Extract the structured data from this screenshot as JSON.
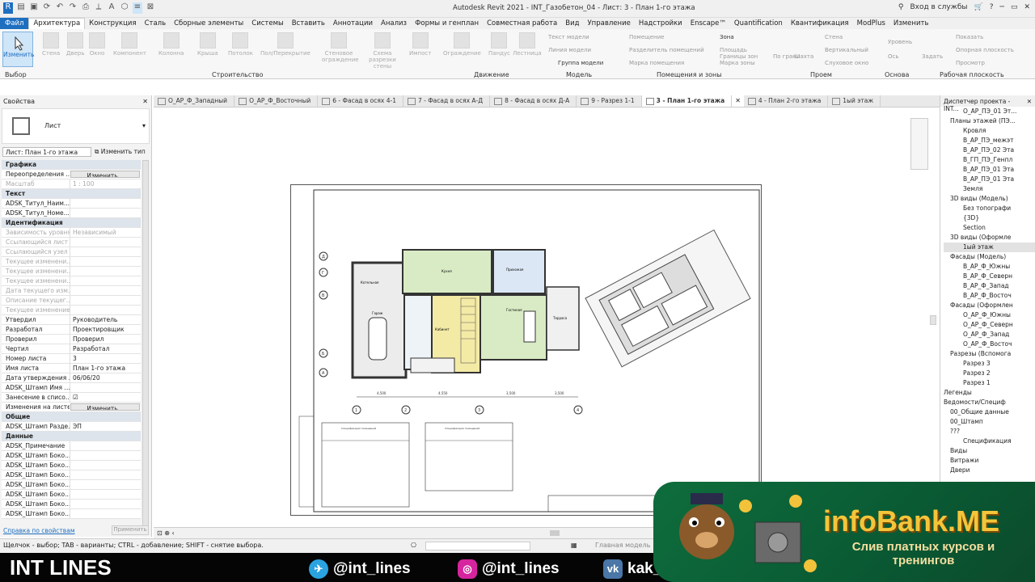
{
  "window": {
    "title": "Autodesk Revit 2021 - INT_Газобетон_04 - Лист: 3 - План 1-го этажа",
    "signin": "Вход в службы"
  },
  "menu": [
    "Файл",
    "Архитектура",
    "Конструкция",
    "Сталь",
    "Сборные элементы",
    "Системы",
    "Вставить",
    "Аннотации",
    "Анализ",
    "Формы и генплан",
    "Совместная работа",
    "Вид",
    "Управление",
    "Надстройки",
    "Enscape™",
    "Quantification",
    "Квантификация",
    "ModPlus",
    "Изменить"
  ],
  "ribbon": {
    "select_label": "Изменить",
    "select_group": "Выбор",
    "build_items": [
      "Стена",
      "Дверь",
      "Окно",
      "Компонент",
      "Колонна",
      "Крыша",
      "Потолок",
      "Пол/Перекрытие",
      "Стеновое ограждение",
      "Схема разрезки стены",
      "Импост",
      "Ограждение",
      "Пандус",
      "Лестница"
    ],
    "model_items": [
      "Текст модели",
      "Линия модели",
      "Группа модели"
    ],
    "room_items": [
      "Помещение",
      "Разделитель помещений",
      "Марка помещения",
      "Зона",
      "Площадь",
      "Границы зон",
      "Марка зоны"
    ],
    "opening_items": [
      "По грани",
      "Шахта",
      "Стена",
      "Вертикальный",
      "Слуховое окно"
    ],
    "datum_items": [
      "Уровень",
      "Ось"
    ],
    "wp_items": [
      "Задать",
      "Показать",
      "Опорная плоскость",
      "Просмотр"
    ],
    "groups": [
      "Выбор",
      "Строительство",
      "Движение",
      "Модель",
      "Помещения и зоны",
      "Проем",
      "Основа",
      "Рабочая плоскость"
    ]
  },
  "properties": {
    "header": "Свойства",
    "type_name": "Лист",
    "filter_value": "Лист: План 1-го этажа",
    "edit_type": "Изменить тип",
    "rows": [
      {
        "sec": "Графика"
      },
      {
        "k": "Переопределения ...",
        "v": "Изменить...",
        "btn": true
      },
      {
        "k": "Масштаб",
        "v": "1 : 100",
        "dim": true
      },
      {
        "sec": "Текст"
      },
      {
        "k": "ADSK_Титул_Наим...",
        "v": ""
      },
      {
        "k": "ADSK_Титул_Номе...",
        "v": ""
      },
      {
        "sec": "Идентификация"
      },
      {
        "k": "Зависимость уровня",
        "v": "Независимый",
        "dim": true
      },
      {
        "k": "Ссылающийся лист",
        "v": "",
        "dim": true
      },
      {
        "k": "Ссылающийся узел",
        "v": "",
        "dim": true
      },
      {
        "k": "Текущее изменени...",
        "v": "",
        "dim": true
      },
      {
        "k": "Текущее изменени...",
        "v": "",
        "dim": true
      },
      {
        "k": "Текущее изменени...",
        "v": "",
        "dim": true
      },
      {
        "k": "Дата текущего изм...",
        "v": "",
        "dim": true
      },
      {
        "k": "Описание текущег...",
        "v": "",
        "dim": true
      },
      {
        "k": "Текущее изменение",
        "v": "",
        "dim": true
      },
      {
        "k": "Утвердил",
        "v": "Руководитель"
      },
      {
        "k": "Разработал",
        "v": "Проектировщик"
      },
      {
        "k": "Проверил",
        "v": "Проверил"
      },
      {
        "k": "Чертил",
        "v": "Разработал"
      },
      {
        "k": "Номер листа",
        "v": "3"
      },
      {
        "k": "Имя листа",
        "v": "План 1-го этажа"
      },
      {
        "k": "Дата утверждения ...",
        "v": "06/06/20"
      },
      {
        "k": "ADSK_Штамп Имя ...",
        "v": ""
      },
      {
        "k": "Занесение в списо...",
        "v": "☑"
      },
      {
        "k": "Изменения на листе",
        "v": "Изменить...",
        "btn": true
      },
      {
        "sec": "Общие"
      },
      {
        "k": "ADSK_Штамп Разде...",
        "v": "ЭП"
      },
      {
        "sec": "Данные"
      },
      {
        "k": "ADSK_Примечание",
        "v": ""
      },
      {
        "k": "ADSK_Штамп Боко...",
        "v": ""
      },
      {
        "k": "ADSK_Штамп Боко...",
        "v": ""
      },
      {
        "k": "ADSK_Штамп Боко...",
        "v": ""
      },
      {
        "k": "ADSK_Штамп Боко...",
        "v": ""
      },
      {
        "k": "ADSK_Штамп Боко...",
        "v": ""
      },
      {
        "k": "ADSK_Штамп Боко...",
        "v": ""
      },
      {
        "k": "ADSK_Штамп Боко...",
        "v": ""
      }
    ],
    "help_link": "Справка по свойствам",
    "apply": "Применить"
  },
  "tabs": [
    {
      "label": "О_АР_Ф_Западный"
    },
    {
      "label": "О_АР_Ф_Восточный"
    },
    {
      "label": "6 - Фасад в осях 4-1"
    },
    {
      "label": "7 - Фасад в осях А-Д"
    },
    {
      "label": "8 - Фасад в осях Д-А"
    },
    {
      "label": "9 - Разрез 1-1"
    },
    {
      "label": "3 - План 1-го этажа",
      "active": true
    },
    {
      "label": "4 - План 2-го этажа"
    },
    {
      "label": "1ый этаж"
    }
  ],
  "project_browser": {
    "header": "Диспетчер проекта - INT...",
    "items": [
      "О_АР_ПЭ_01 Эт...",
      "Планы этажей (ПЭ...",
      "Кровля",
      "В_АР_ПЭ_межэт",
      "В_АР_ПЭ_02 Эта",
      "В_ГП_ПЭ_Генпл",
      "В_АР_ПЭ_01 Эта",
      "В_АР_ПЭ_01 Эта",
      "Земля",
      "3D виды (Модель)",
      "Без топографи",
      "{3D}",
      "Section",
      "3D виды (Оформле",
      "1ый этаж",
      "Фасады (Модель)",
      "В_АР_Ф_Южны",
      "В_АР_Ф_Северн",
      "В_АР_Ф_Запад",
      "В_АР_Ф_Восточ",
      "Фасады (Оформлен",
      "О_АР_Ф_Южны",
      "О_АР_Ф_Северн",
      "О_АР_Ф_Запад",
      "О_АР_Ф_Восточ",
      "Разрезы (Вспомога",
      "Разрез 3",
      "Разрез 2",
      "Разрез 1",
      "Легенды",
      "Ведомости/Специф",
      "00_Общие данные",
      "00_Штамп",
      "???",
      "Спецификация",
      "Виды",
      "Витражи",
      "Двери"
    ]
  },
  "drawing": {
    "rooms": [
      "Прихожая",
      "Кухня",
      "Гостиная",
      "Терраса",
      "Котельная",
      "Гараж",
      "Кабинет"
    ],
    "dims": [
      "4,500",
      "4,550",
      "3,500",
      "3,500"
    ],
    "axis_bottom": [
      "1",
      "2",
      "3",
      "4"
    ],
    "axis_left": [
      "Д",
      "Г",
      "В",
      "Б",
      "А"
    ],
    "schedule_title": "Спецификация помещений"
  },
  "status_text": "Щелчок - выбор; TAB - варианты; CTRL - добавление; SHIFT - снятие выбора.",
  "view_model": "Главная модель",
  "banner": {
    "brand": "INT LINES",
    "telegram": "@int_lines",
    "instagram": "@int_lines",
    "vk": "kak_",
    "promo_logo": "infoBank.ME",
    "promo_sub": "Слив платных курсов и тренингов"
  }
}
